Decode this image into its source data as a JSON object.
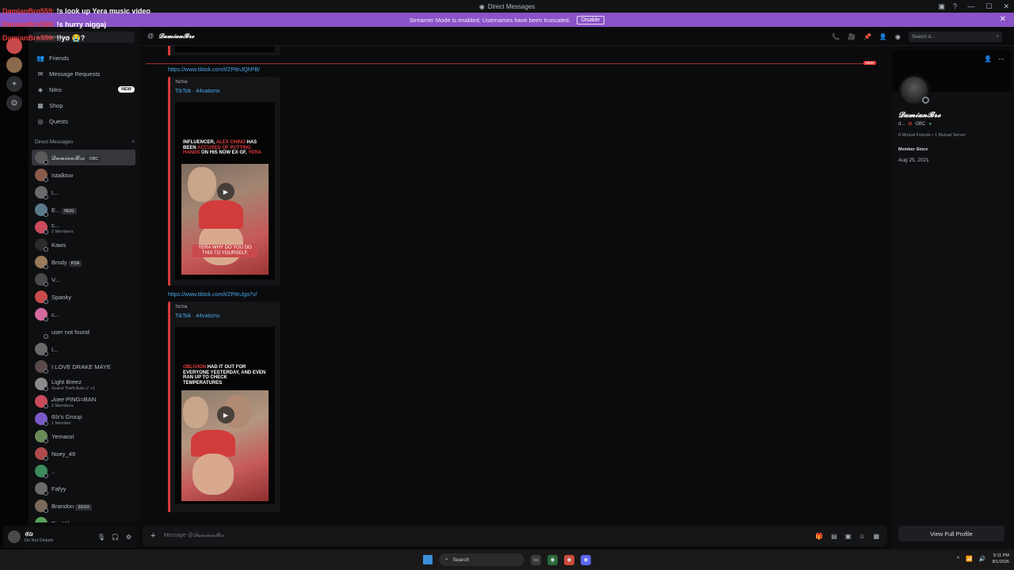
{
  "window": {
    "title": "Direct Messages"
  },
  "overlay_chat": [
    {
      "user": "DamianBro559:",
      "text": "!s look up Yera music video"
    },
    {
      "user": "DamianBro559:",
      "text": "!s hurry niggaj"
    },
    {
      "user": "DamianBro559:",
      "text": "!!yo 😭?"
    }
  ],
  "streamer_bar": {
    "text": "Streamer Mode is enabled. Usernames have been truncated.",
    "button": "Disable"
  },
  "sidebar": {
    "search_placeholder": "a conversation",
    "nav": [
      {
        "label": "Friends",
        "icon": "friends-icon"
      },
      {
        "label": "Message Requests",
        "icon": "mail-icon"
      },
      {
        "label": "Nitro",
        "icon": "nitro-icon",
        "badge": "NEW"
      },
      {
        "label": "Shop",
        "icon": "shop-icon"
      },
      {
        "label": "Quests",
        "icon": "quests-icon"
      }
    ],
    "dm_header": "Direct Messages",
    "dm_add": "+",
    "dms": [
      {
        "name": "𝓓𝓪𝓶𝓲𝓪𝓷𝓑𝓻𝓸",
        "tag": "OBC",
        "color": "#5a5a5a",
        "active": true
      },
      {
        "name": "Istalktuv",
        "color": "#8a5a4a"
      },
      {
        "name": "I...",
        "color": "#6a6a6a"
      },
      {
        "name": "E...",
        "tag": "NUG",
        "color": "#5a7a8a"
      },
      {
        "name": "c...",
        "sub": "2 Members",
        "color": "#c94a5a"
      },
      {
        "name": "Kaws",
        "color": "#2a2a2a"
      },
      {
        "name": "Brody",
        "tag": "PZA",
        "color": "#9a7a5a"
      },
      {
        "name": "V...",
        "color": "#4a4a4a"
      },
      {
        "name": "Spanky",
        "color": "#c94a4a"
      },
      {
        "name": "c...",
        "color": "#d46aa0"
      },
      {
        "name": "user not found",
        "color": "#0e0f11"
      },
      {
        "name": "I...",
        "color": "#6a6a6a"
      },
      {
        "name": "I LOVE DRAKE MAYE",
        "color": "#5a4a4a"
      },
      {
        "name": "Light Breez",
        "sub": "Grand Theft Auto V +1",
        "color": "#8a8a8a"
      },
      {
        "name": "𝐽𝑜𝑒𝑒 PING=BAN",
        "sub": "2 Members",
        "color": "#c94a5a"
      },
      {
        "name": "𝔊𝔩𝔵's Group",
        "sub": "1 Member",
        "color": "#7a5ac9"
      },
      {
        "name": "Yemaozi",
        "color": "#6a8a5a"
      },
      {
        "name": "Noey_49",
        "color": "#b04a4a"
      },
      {
        "name": "..",
        "color": "#3a8a5a"
      },
      {
        "name": "Fafyy",
        "color": "#6a6a6a"
      },
      {
        "name": "Brandon",
        "tag": "2GXX",
        "color": "#7a6a5a"
      },
      {
        "name": "Big Mike",
        "color": "#5aa05a"
      }
    ]
  },
  "user_panel": {
    "name": "𝔊𝔩𝔵",
    "status": "Do Not Disturb"
  },
  "chat": {
    "header_name": "𝓓𝓪𝓶𝓲𝓪𝓷𝓑𝓻𝓸",
    "search_placeholder": "Search d...",
    "new_label": "NEW",
    "messages": [
      {
        "link": "https://www.tiktok.com/t/ZP8nJQhPB/",
        "provider": "TikTok",
        "title": "TikTok · 44vatomx",
        "caption_pre": "Influencer,",
        "caption_hl": "Alex Chino",
        "caption_mid": "has been",
        "caption_hl2": "accused of putting hands",
        "caption_post": "on his now ex gf,",
        "caption_hl3": "Yera",
        "bottom_text": "YERA WHY DO YOU DO THIS TO YOURSELF."
      },
      {
        "link": "https://www.tiktok.com/t/ZP8nJgo7v/",
        "provider": "TikTok",
        "title": "TikTok · 44vatomx",
        "caption_hl": "Oblivion",
        "caption_post": "had it out for everyone yesterday, and even ran up to check temperatures"
      }
    ],
    "composer_placeholder": "Message @𝓓𝓪𝓶𝓲𝓪𝓷𝓑𝓻𝓸"
  },
  "profile": {
    "display_name": "𝓓𝓪𝓶𝓲𝓪𝓷𝓑𝓻𝓸",
    "username": "d...",
    "tag": "OBC",
    "mutual": "8 Mutual Friends • 1 Mutual Server",
    "member_since_label": "Member Since",
    "member_since": "Aug 25, 2021",
    "full_profile_button": "View Full Profile"
  },
  "taskbar": {
    "search": "Search",
    "time": "9:11 PM",
    "date": "8/1/2026"
  },
  "colors": {
    "accent": "#8a53c7",
    "link": "#4aa8e8",
    "embed_border": "#d63a3a"
  }
}
